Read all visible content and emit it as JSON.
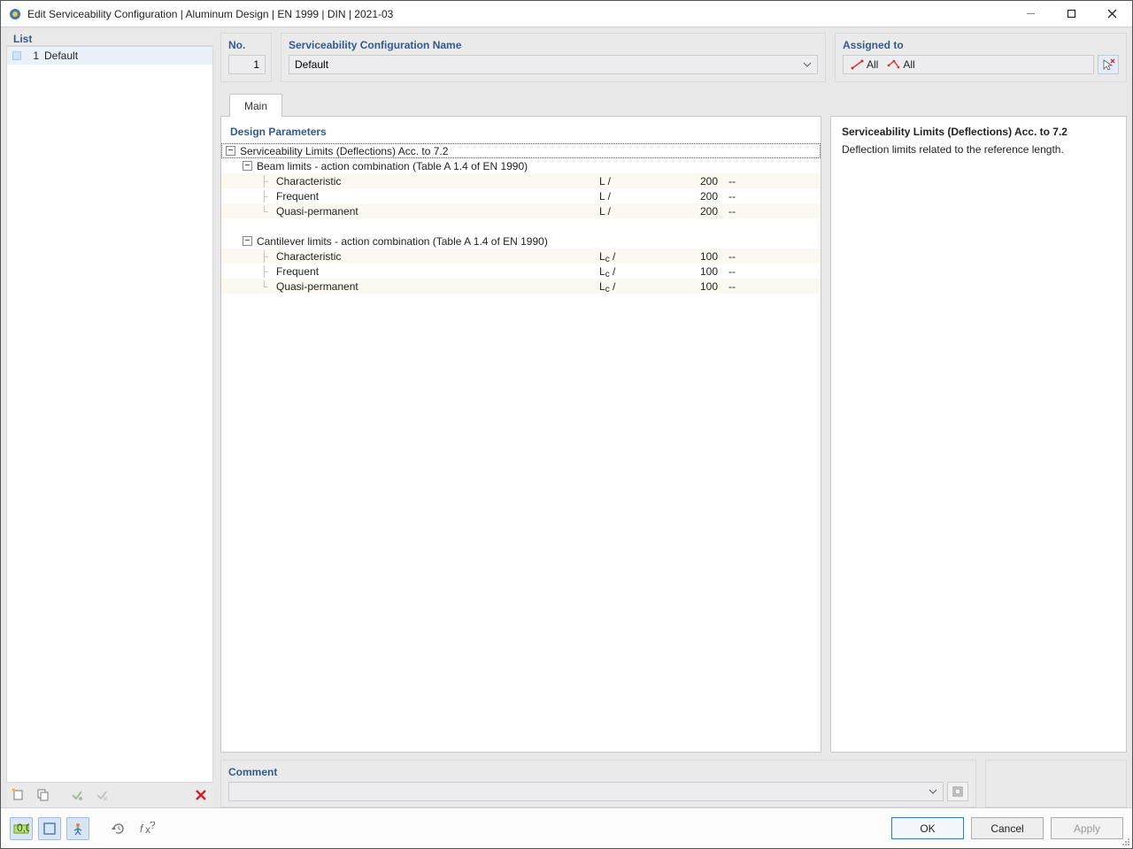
{
  "window": {
    "title": "Edit Serviceability Configuration | Aluminum Design | EN 1999 | DIN | 2021-03"
  },
  "list": {
    "title": "List",
    "items": [
      {
        "num": "1",
        "label": "Default"
      }
    ]
  },
  "header": {
    "no_label": "No.",
    "no_value": "1",
    "name_label": "Serviceability Configuration Name",
    "name_value": "Default",
    "assigned_label": "Assigned to",
    "assigned_tag1": "All",
    "assigned_tag2": "All"
  },
  "tabs": {
    "main": "Main"
  },
  "params": {
    "section_title": "Design Parameters",
    "root": "Serviceability Limits (Deflections) Acc. to 7.2",
    "group1": {
      "title": "Beam limits - action combination (Table A 1.4 of EN 1990)",
      "rows": [
        {
          "name": "Characteristic",
          "sym": "L /",
          "val": "200",
          "unit": "--"
        },
        {
          "name": "Frequent",
          "sym": "L /",
          "val": "200",
          "unit": "--"
        },
        {
          "name": "Quasi-permanent",
          "sym": "L /",
          "val": "200",
          "unit": "--"
        }
      ]
    },
    "group2": {
      "title": "Cantilever limits - action combination (Table A 1.4 of EN 1990)",
      "rows": [
        {
          "name": "Characteristic",
          "sym_base": "L",
          "sym_sub": "c",
          "sym_tail": " /",
          "val": "100",
          "unit": "--"
        },
        {
          "name": "Frequent",
          "sym_base": "L",
          "sym_sub": "c",
          "sym_tail": " /",
          "val": "100",
          "unit": "--"
        },
        {
          "name": "Quasi-permanent",
          "sym_base": "L",
          "sym_sub": "c",
          "sym_tail": " /",
          "val": "100",
          "unit": "--"
        }
      ]
    }
  },
  "description": {
    "heading": "Serviceability Limits (Deflections) Acc. to 7.2",
    "text": "Deflection limits related to the reference length."
  },
  "comment": {
    "label": "Comment",
    "value": ""
  },
  "footer": {
    "ok": "OK",
    "cancel": "Cancel",
    "apply": "Apply"
  },
  "icons": {
    "new": "new-icon",
    "copy": "copy-icon",
    "include": "include-icon",
    "exclude": "exclude-icon",
    "delete": "delete-icon",
    "units": "units-icon",
    "view": "view-icon",
    "person": "person-icon",
    "history": "history-icon",
    "fx": "function-icon",
    "assign_pick": "assign-pick-icon",
    "paste": "paste-icon"
  }
}
